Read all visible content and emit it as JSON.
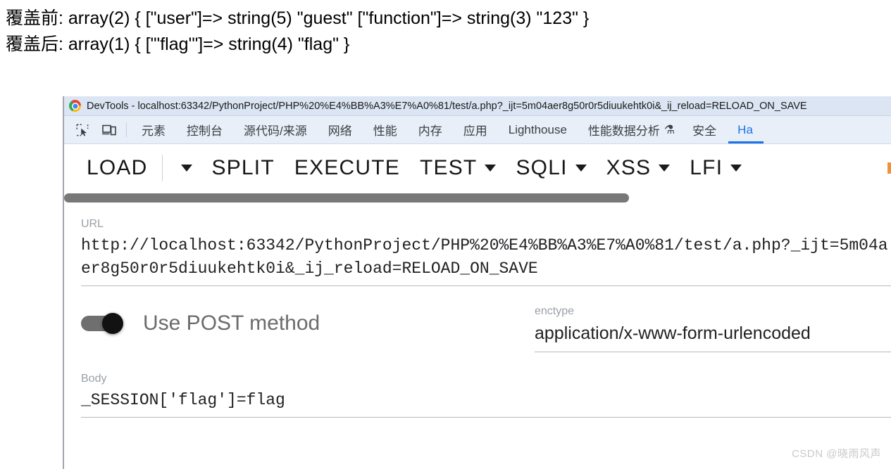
{
  "php_output": {
    "lines": [
      "覆盖前: array(2) { [\"user\"]=> string(5) \"guest\" [\"function\"]=> string(3) \"123\" }",
      "覆盖后: array(1) { [\"'flag'\"]=> string(4) \"flag\" }"
    ]
  },
  "devtools": {
    "window_title": "DevTools - localhost:63342/PythonProject/PHP%20%E4%BB%A3%E7%A0%81/test/a.php?_ijt=5m04aer8g50r0r5diuukehtk0i&_ij_reload=RELOAD_ON_SAVE",
    "icons": [
      {
        "name": "inspect-element-icon",
        "label": "检查元素"
      },
      {
        "name": "device-toolbar-icon",
        "label": "设备工具栏"
      }
    ],
    "tabs": [
      {
        "label": "元素",
        "active": false,
        "flask": false
      },
      {
        "label": "控制台",
        "active": false,
        "flask": false
      },
      {
        "label": "源代码/来源",
        "active": false,
        "flask": false
      },
      {
        "label": "网络",
        "active": false,
        "flask": false
      },
      {
        "label": "性能",
        "active": false,
        "flask": false
      },
      {
        "label": "内存",
        "active": false,
        "flask": false
      },
      {
        "label": "应用",
        "active": false,
        "flask": false
      },
      {
        "label": "Lighthouse",
        "active": false,
        "flask": false
      },
      {
        "label": "性能数据分析",
        "active": false,
        "flask": true
      },
      {
        "label": "安全",
        "active": false,
        "flask": false
      },
      {
        "label": "Ha",
        "active": true,
        "flask": false
      }
    ],
    "accent_color": "#1a73e8",
    "titlebar_color": "#dbe5f3",
    "tabstrip_color": "#e9eff9"
  },
  "hackbar": {
    "toolbar": [
      {
        "label": "LOAD",
        "caret": false,
        "separator_after": true
      },
      {
        "label": "",
        "caret": true,
        "separator_after": false
      },
      {
        "label": "SPLIT",
        "caret": false,
        "separator_after": false
      },
      {
        "label": "EXECUTE",
        "caret": false,
        "separator_after": false
      },
      {
        "label": "TEST",
        "caret": true,
        "separator_after": false
      },
      {
        "label": "SQLI",
        "caret": true,
        "separator_after": false
      },
      {
        "label": "XSS",
        "caret": true,
        "separator_after": false
      },
      {
        "label": "LFI",
        "caret": true,
        "separator_after": false
      }
    ],
    "url": {
      "label": "URL",
      "value": "http://localhost:63342/PythonProject/PHP%20%E4%BB%A3%E7%A0%81/test/a.php?_ijt=5m04aer8g50r0r5diuukehtk0i&_ij_reload=RELOAD_ON_SAVE"
    },
    "post_toggle": {
      "label": "Use POST method",
      "enabled": true
    },
    "enctype": {
      "label": "enctype",
      "value": "application/x-www-form-urlencoded"
    },
    "body": {
      "label": "Body",
      "value": "_SESSION['flag']=flag"
    }
  },
  "watermark": {
    "text": "CSDN @晓雨风声"
  }
}
